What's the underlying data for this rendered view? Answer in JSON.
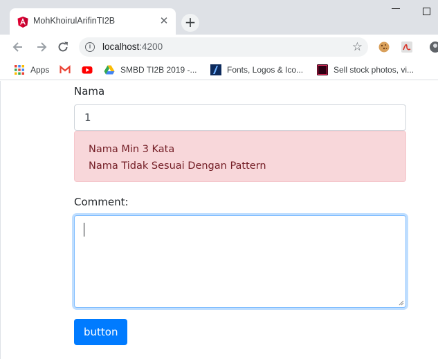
{
  "browser": {
    "tab_title": "MohKhoirulArifinTI2B",
    "url_host": "localhost",
    "url_port": ":4200",
    "bookmarks": [
      {
        "label": "Apps",
        "icon": "apps-grid-icon"
      },
      {
        "label": "",
        "icon": "gmail-icon"
      },
      {
        "label": "",
        "icon": "youtube-icon"
      },
      {
        "label": "SMBD TI2B 2019 -...",
        "icon": "google-drive-icon"
      },
      {
        "label": "Fonts, Logos & Ico...",
        "icon": "site-icon"
      },
      {
        "label": "Sell stock photos, vi...",
        "icon": "adobe-stock-icon"
      }
    ]
  },
  "form": {
    "nama_label": "Nama",
    "nama_value": "1",
    "errors": [
      "Nama Min 3 Kata",
      "Nama Tidak Sesuai Dengan Pattern"
    ],
    "comment_label": "Comment:",
    "comment_value": "",
    "button_label": "button"
  },
  "colors": {
    "primary": "#007bff",
    "danger_bg": "#f8d7da",
    "danger_text": "#721c24",
    "focus_border": "#80bdff"
  }
}
